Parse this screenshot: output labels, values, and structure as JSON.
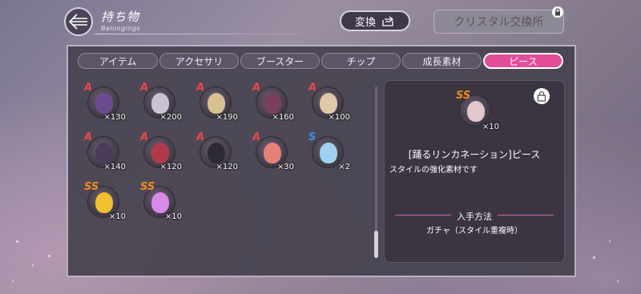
{
  "header": {
    "title": "持ち物",
    "subtitle": "Belongings",
    "swap_label": "変換",
    "crystal_exchange_label": "クリスタル交換所"
  },
  "tabs": [
    {
      "label": "アイテム",
      "active": false
    },
    {
      "label": "アクセサリ",
      "active": false
    },
    {
      "label": "ブースター",
      "active": false
    },
    {
      "label": "チップ",
      "active": false
    },
    {
      "label": "成長素材",
      "active": false
    },
    {
      "label": "ピース",
      "active": true
    }
  ],
  "items": [
    {
      "rank": "A",
      "qty": "×130",
      "color": "#6b4a8e"
    },
    {
      "rank": "A",
      "qty": "×200",
      "color": "#c9c3d6"
    },
    {
      "rank": "A",
      "qty": "×190",
      "color": "#d9c090"
    },
    {
      "rank": "A",
      "qty": "×160",
      "color": "#7a3f5a"
    },
    {
      "rank": "A",
      "qty": "×100",
      "color": "#e0c8a8"
    },
    {
      "rank": "A",
      "qty": "×140",
      "color": "#4a3d5c"
    },
    {
      "rank": "A",
      "qty": "×120",
      "color": "#b23a48"
    },
    {
      "rank": "A",
      "qty": "×120",
      "color": "#2e2a33"
    },
    {
      "rank": "A",
      "qty": "×30",
      "color": "#e8807a"
    },
    {
      "rank": "S",
      "qty": "×2",
      "color": "#9fd2f0"
    },
    {
      "rank": "SS",
      "qty": "×10",
      "color": "#f0c030"
    },
    {
      "rank": "SS",
      "qty": "×10",
      "color": "#d88ae8"
    }
  ],
  "detail": {
    "rank": "SS",
    "qty": "×10",
    "name": "[踊るリンカネーション]ピース",
    "description": "スタイルの強化素材です",
    "how_to_get_title": "入手方法",
    "how_to_get_text": "ガチャ（スタイル重複時）"
  },
  "colors": {
    "accent_pink": "#e34e9a",
    "rank_a": "#e8474e",
    "rank_s": "#3f8df0",
    "rank_ss": "#f28a1e"
  }
}
